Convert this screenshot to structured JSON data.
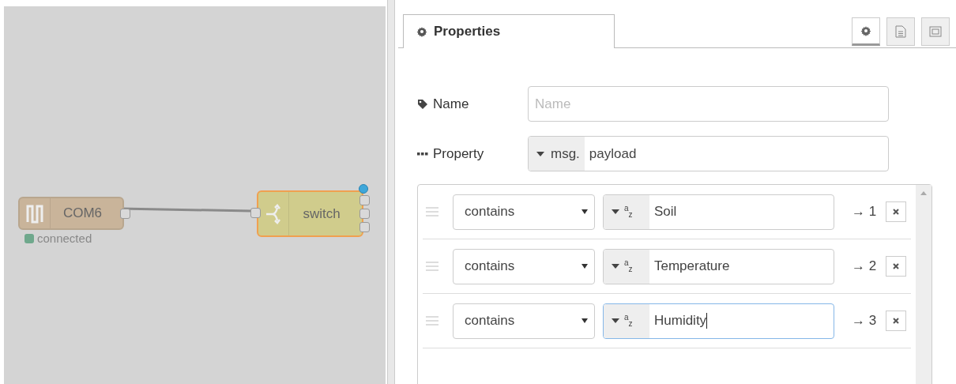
{
  "canvas": {
    "nodes": [
      {
        "kind": "serial",
        "label": "COM6",
        "selected": false,
        "status": {
          "text": "connected",
          "color": "#6fa88c"
        }
      },
      {
        "kind": "switch",
        "label": "switch",
        "selected": true,
        "changed": true
      }
    ]
  },
  "panel": {
    "tabs": [
      {
        "label": "Properties",
        "selected": true
      }
    ],
    "tool_buttons": [
      {
        "kind": "gear",
        "selected": true
      },
      {
        "kind": "doc",
        "selected": false
      },
      {
        "kind": "frame",
        "selected": false
      }
    ],
    "name": {
      "label": "Name",
      "placeholder": "Name"
    },
    "property": {
      "label": "Property",
      "prefix": "msg.",
      "value": "payload"
    },
    "rules": [
      {
        "operator": "contains",
        "type": "$^{a}$$_{z}$",
        "value": "Soil",
        "output": "→ 1",
        "focused": false
      },
      {
        "operator": "contains",
        "type": "$^{a}$$_{z}$",
        "value": "Temperature",
        "output": "→ 2",
        "focused": false
      },
      {
        "operator": "contains",
        "type": "$^{a}$$_{z}$",
        "value": "Humidity",
        "output": "→ 3",
        "focused": true
      }
    ]
  }
}
